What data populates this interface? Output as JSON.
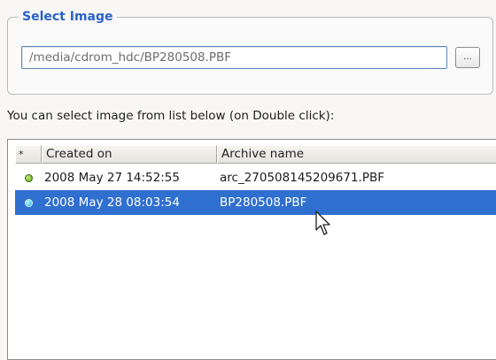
{
  "select_image": {
    "legend": "Select Image",
    "path_value": "/media/cdrom_hdc/BP280508.PBF",
    "browse_label": "..."
  },
  "instruction": "You can select image from list below (on Double click):",
  "list": {
    "columns": {
      "marker": "*",
      "created": "Created on",
      "archive": "Archive name"
    },
    "rows": [
      {
        "created": "2008 May 27 14:52:55",
        "archive": "arc_270508145209671.PBF",
        "status_icon": "green-dot-icon",
        "selected": false
      },
      {
        "created": "2008 May 28 08:03:54",
        "archive": "BP280508.PBF",
        "status_icon": "cyan-dot-icon",
        "selected": true
      }
    ]
  },
  "colors": {
    "legend": "#2a63c8",
    "selection": "#2f6fd0",
    "field_border": "#5f86b6"
  }
}
